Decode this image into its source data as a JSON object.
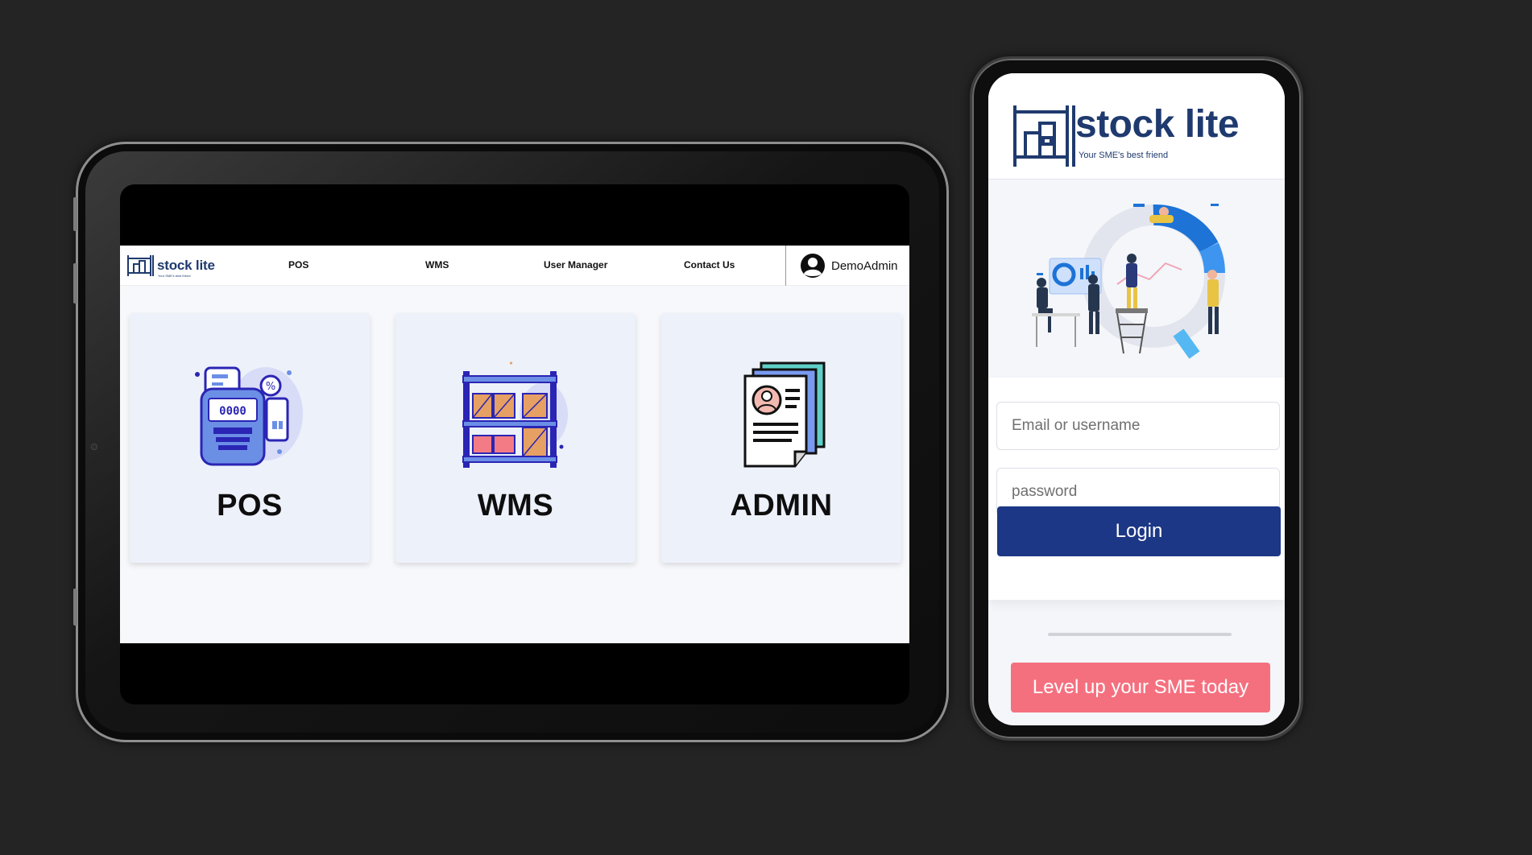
{
  "tablet": {
    "brand": {
      "name": "stock lite",
      "tagline": "Your SME's best friend"
    },
    "nav": [
      {
        "label": "POS"
      },
      {
        "label": "WMS"
      },
      {
        "label": "User Manager"
      },
      {
        "label": "Contact Us"
      }
    ],
    "user": {
      "name": "DemoAdmin",
      "icon": "user-circle-icon"
    },
    "cards": [
      {
        "label": "POS",
        "icon": "pos-terminal-icon"
      },
      {
        "label": "WMS",
        "icon": "warehouse-shelf-icon"
      },
      {
        "label": "ADMIN",
        "icon": "admin-documents-icon"
      }
    ]
  },
  "phone": {
    "brand": {
      "name": "stock lite",
      "tagline": "Your SME's best friend"
    },
    "illustration": "team-analytics-illustration",
    "login": {
      "email_placeholder": "Email or username",
      "password_placeholder": "password",
      "button_label": "Login"
    },
    "cta_label": "Level up your SME today"
  },
  "colors": {
    "brand_navy": "#1f3a6e",
    "login_button": "#1c3785",
    "cta_button": "#f5707f",
    "card_background": "#edf1fa",
    "backdrop": "#242424"
  }
}
